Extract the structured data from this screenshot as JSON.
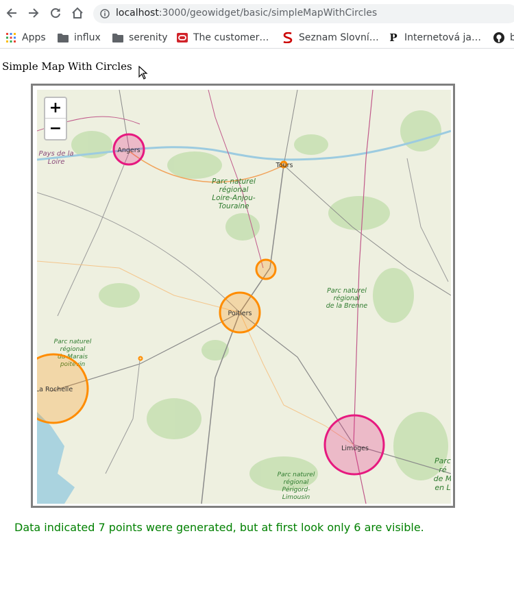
{
  "browser": {
    "url_host": "localhost",
    "url_rest": ":3000/geowidget/basic/simpleMapWithCircles",
    "bookmarks": [
      {
        "label": "Apps",
        "icon": "apps-grid-icon"
      },
      {
        "label": "influx",
        "icon": "folder-icon"
      },
      {
        "label": "serenity",
        "icon": "folder-icon"
      },
      {
        "label": "The customer…",
        "icon": "oracle-icon"
      },
      {
        "label": "Seznam Slovní…",
        "icon": "seznam-icon"
      },
      {
        "label": "Internetová ja…",
        "icon": "p-letter-icon"
      },
      {
        "label": "b",
        "icon": "github-icon"
      }
    ]
  },
  "page": {
    "title": "Simple Map With Circles",
    "note": "Data indicated 7 points were generated, but at first look only 6 are visible.",
    "note_color": "#008000"
  },
  "map": {
    "zoom_in": "+",
    "zoom_out": "−",
    "cities": {
      "angers": "Angers",
      "tours": "Tours",
      "poitiers": "Poitiers",
      "la_rochelle": "La Rochelle",
      "limoges": "Limoges"
    },
    "regions": {
      "pays_de_la_loire": [
        "Pays de la",
        "Loire"
      ],
      "loire_anjou": [
        "Parc naturel",
        "régional",
        "Loire-Anjou-",
        "Touraine"
      ],
      "brenne": [
        "Parc naturel",
        "régional",
        "de la Brenne"
      ],
      "marais": [
        "Parc naturel",
        "régional",
        "du Marais",
        "poitevin"
      ],
      "perigord": [
        "Parc naturel",
        "régional",
        "Périgord-",
        "Limousin"
      ],
      "edge": [
        "Parc",
        "ré",
        "de M",
        "en L"
      ]
    },
    "circle_colors": {
      "pink": "#e6197f",
      "orange": "#ff8c00"
    }
  }
}
